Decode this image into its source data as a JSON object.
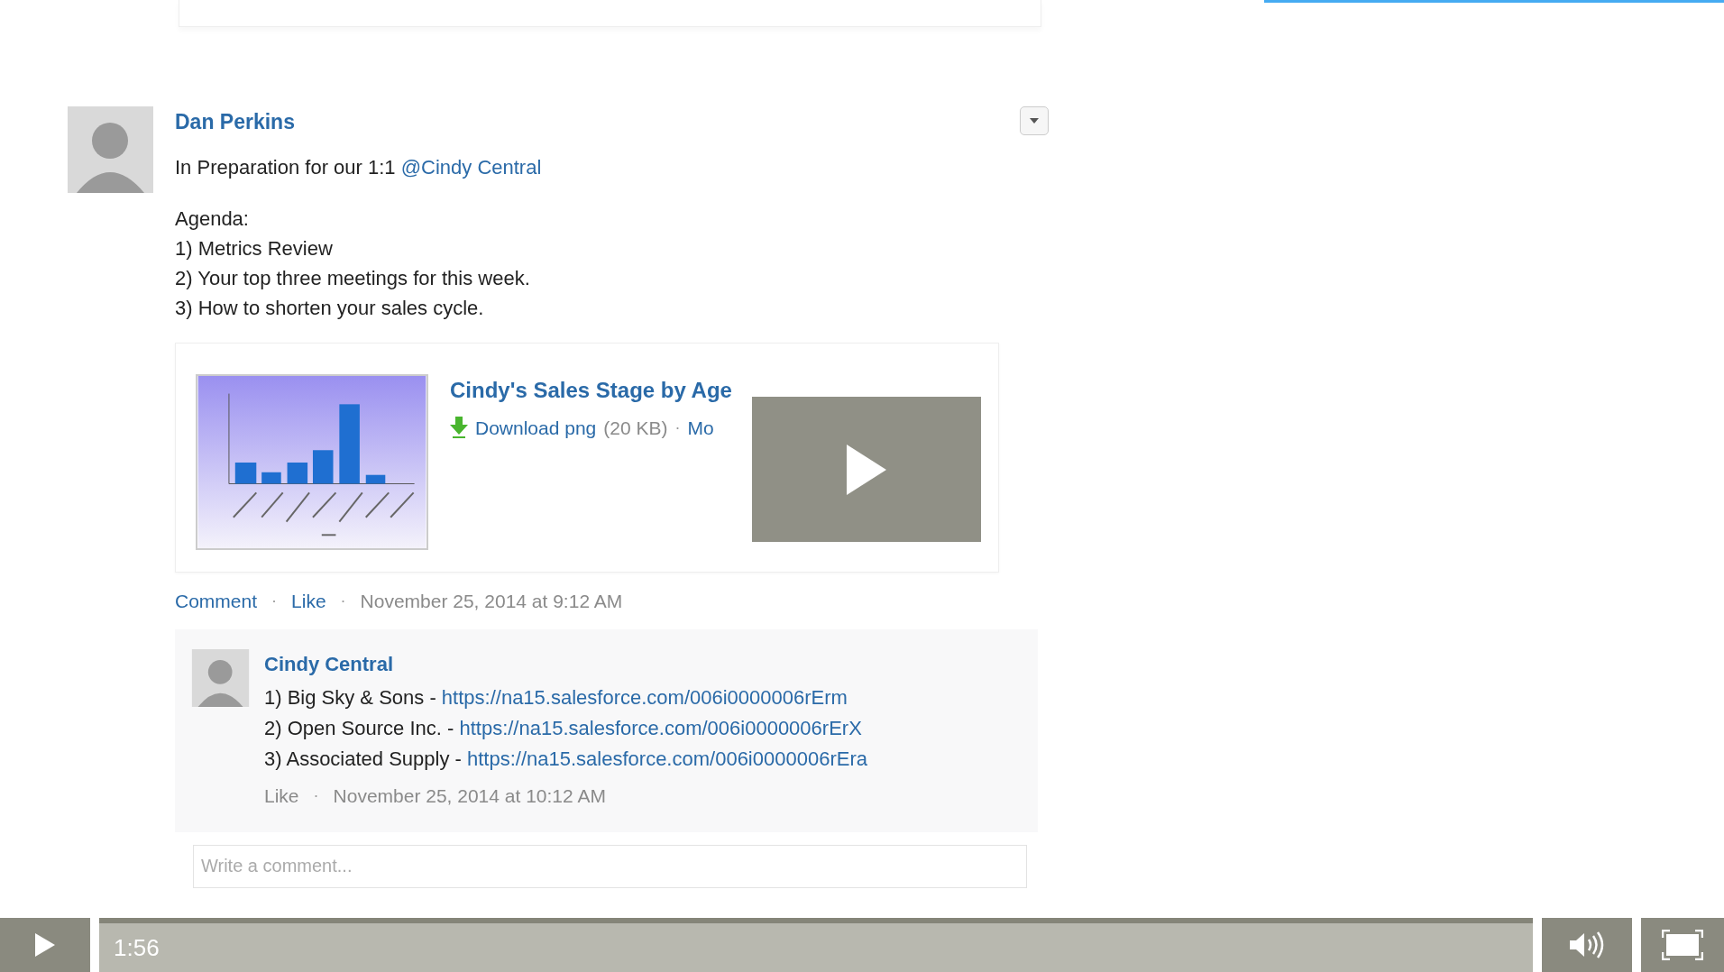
{
  "post": {
    "author": "Dan Perkins",
    "intro": "In Preparation for our 1:1",
    "mention": "@Cindy Central",
    "body_lines": [
      "Agenda:",
      "1) Metrics Review",
      "2) Your top three meetings for this week.",
      "3) How to shorten your sales cycle."
    ],
    "attachment": {
      "title": "Cindy's Sales Stage by Age",
      "items": [
        {
          "kind": "download",
          "text": "Download png"
        },
        {
          "kind": "size",
          "text": "(20 KB)"
        },
        {
          "kind": "dot",
          "text": "·"
        },
        {
          "kind": "more",
          "text": "Mo"
        }
      ]
    },
    "meta": [
      {
        "kind": "link",
        "text": "Comment"
      },
      {
        "kind": "dot",
        "text": "·"
      },
      {
        "kind": "link",
        "text": "Like"
      },
      {
        "kind": "dot",
        "text": "·"
      },
      {
        "kind": "time",
        "text": "November 25, 2014 at 9:12 AM"
      }
    ]
  },
  "comments": [
    {
      "author": "Cindy Central",
      "lines": [
        {
          "text": "1) Big Sky & Sons -",
          "link": "https://na15.salesforce.com/006i0000006rErm"
        },
        {
          "text": "2) Open Source Inc. -",
          "link": "https://na15.salesforce.com/006i0000006rErX"
        },
        {
          "text": "3) Associated Supply -",
          "link": "https://na15.salesforce.com/006i0000006rEra"
        }
      ],
      "meta": [
        {
          "kind": "muted",
          "text": "Like"
        },
        {
          "kind": "dot",
          "text": "·"
        },
        {
          "kind": "time",
          "text": "November 25, 2014 at 10:12 AM"
        }
      ]
    }
  ],
  "comment_field": {
    "placeholder": "Write a comment..."
  },
  "player": {
    "time": "1:56"
  }
}
